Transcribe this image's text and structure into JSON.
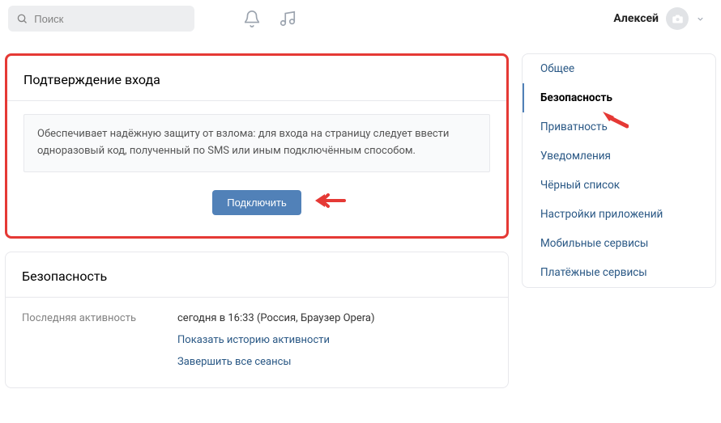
{
  "topbar": {
    "search_placeholder": "Поиск",
    "user_name": "Алексей"
  },
  "confirm_panel": {
    "title": "Подтверждение входа",
    "info_text": "Обеспечивает надёжную защиту от взлома: для входа на страницу следует ввести одноразовый код, полученный по SMS или иным подключённым способом.",
    "connect_button": "Подключить"
  },
  "security_panel": {
    "title": "Безопасность",
    "activity_label": "Последняя активность",
    "activity_value": "сегодня в 16:33 (Россия, Браузер Opera)",
    "history_link": "Показать историю активности",
    "end_sessions_link": "Завершить все сеансы"
  },
  "sidebar": {
    "items": [
      {
        "label": "Общее"
      },
      {
        "label": "Безопасность"
      },
      {
        "label": "Приватность"
      },
      {
        "label": "Уведомления"
      },
      {
        "label": "Чёрный список"
      },
      {
        "label": "Настройки приложений"
      },
      {
        "label": "Мобильные сервисы"
      },
      {
        "label": "Платёжные сервисы"
      }
    ]
  }
}
